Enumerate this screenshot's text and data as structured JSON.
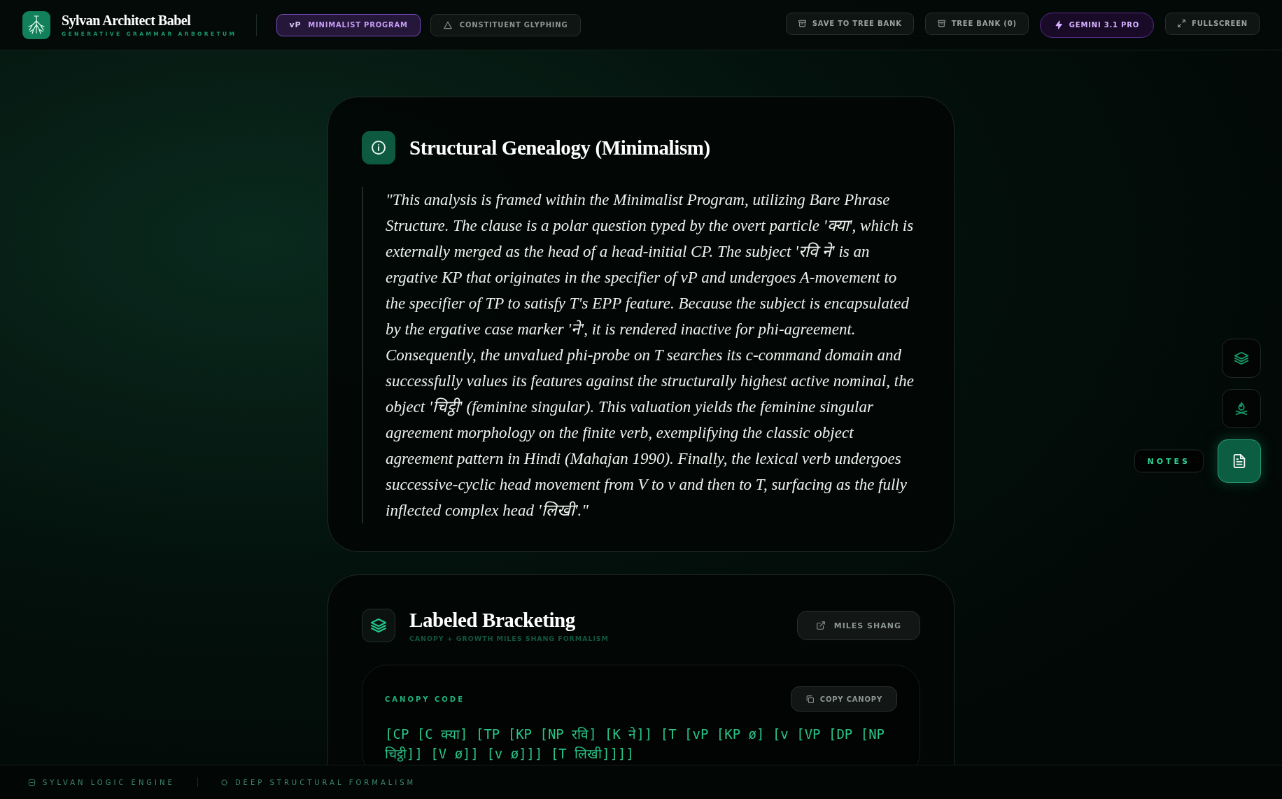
{
  "app": {
    "title": "Sylvan Architect Babel",
    "subtitle": "GENERATIVE GRAMMAR ARBORETUM"
  },
  "modes": [
    {
      "badge": "vP",
      "label": "MINIMALIST PROGRAM",
      "selected": true
    },
    {
      "kind": "glyphing",
      "label": "CONSTITUENT GLYPHING",
      "selected": false
    }
  ],
  "actions": [
    {
      "kind": "save",
      "label": "SAVE TO TREE BANK"
    },
    {
      "kind": "bank",
      "label": "TREE BANK (0)"
    },
    {
      "kind": "model",
      "label": "GEMINI 3.1 PRO"
    },
    {
      "kind": "fullscreen",
      "label": "FULLSCREEN"
    }
  ],
  "genealogy": {
    "title": "Structural Genealogy (Minimalism)",
    "text": "\"This analysis is framed within the Minimalist Program, utilizing Bare Phrase Structure. The clause is a polar question typed by the overt particle 'क्या', which is externally merged as the head of a head-initial CP. The subject 'रवि ने' is an ergative KP that originates in the specifier of vP and undergoes A-movement to the specifier of TP to satisfy T's EPP feature. Because the subject is encapsulated by the ergative case marker 'ने', it is rendered inactive for phi-agreement. Consequently, the unvalued phi-probe on T searches its c-command domain and successfully values its features against the structurally highest active nominal, the object 'चिट्ठी' (feminine singular). This valuation yields the feminine singular agreement morphology on the finite verb, exemplifying the classic object agreement pattern in Hindi (Mahajan 1990). Finally, the lexical verb undergoes successive-cyclic head movement from V to v and then to T, surfacing as the fully inflected complex head 'लिखी'.\""
  },
  "bracketing": {
    "title": "Labeled Bracketing",
    "subtitle": "CANOPY + GROWTH MILES SHANG FORMALISM",
    "link": "MILES SHANG",
    "panel_label": "CANOPY CODE",
    "copy": "COPY CANOPY",
    "code": "[CP [C क्या] [TP [KP [NP रवि] [K ने]] [T [vP [KP ø] [v [VP [DP [NP चिट्ठी]] [V ø]] [v ø]]] [T लिखी]]]]"
  },
  "rail": [
    {
      "kind": "layers",
      "selected": false
    },
    {
      "kind": "campfire",
      "selected": false
    },
    {
      "kind": "notes",
      "label": "NOTES",
      "selected": true
    }
  ],
  "footer": [
    {
      "kind": "engine",
      "label": "SYLVAN LOGIC ENGINE"
    },
    {
      "kind": "formalism",
      "label": "DEEP STRUCTURAL FORMALISM"
    }
  ]
}
